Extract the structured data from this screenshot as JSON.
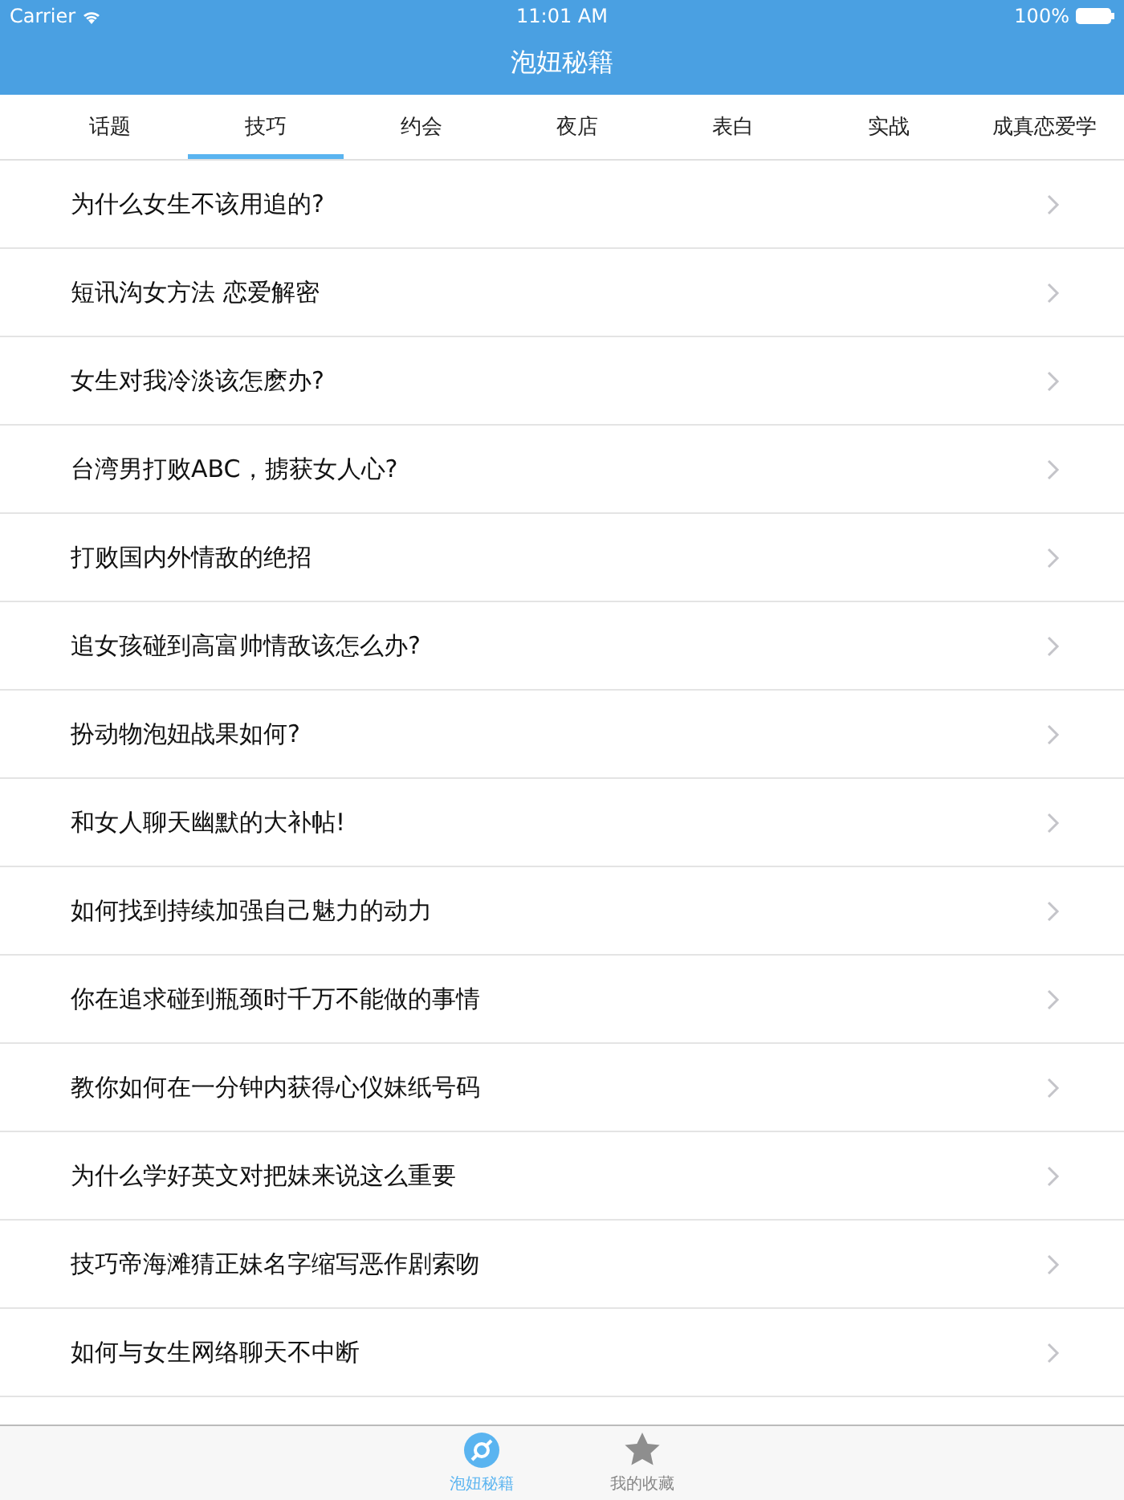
{
  "status_bar": {
    "carrier": "Carrier",
    "time": "11:01 AM",
    "battery": "100%"
  },
  "nav_bar": {
    "title": "泡妞秘籍"
  },
  "tabs": [
    {
      "label": "话题",
      "selected": false
    },
    {
      "label": "技巧",
      "selected": true
    },
    {
      "label": "约会",
      "selected": false
    },
    {
      "label": "夜店",
      "selected": false
    },
    {
      "label": "表白",
      "selected": false
    },
    {
      "label": "实战",
      "selected": false
    },
    {
      "label": "成真恋爱学",
      "selected": false
    }
  ],
  "articles": [
    {
      "title": "为什么女生不该用追的?"
    },
    {
      "title": "短讯沟女方法 恋爱解密"
    },
    {
      "title": "女生对我冷淡该怎麽办?"
    },
    {
      "title": "台湾男打败ABC，掳获女人心?"
    },
    {
      "title": "打败国内外情敌的绝招"
    },
    {
      "title": "追女孩碰到高富帅情敌该怎么办?"
    },
    {
      "title": "扮动物泡妞战果如何?"
    },
    {
      "title": "和女人聊天幽默的大补帖!"
    },
    {
      "title": "如何找到持续加强自己魅力的动力"
    },
    {
      "title": "你在追求碰到瓶颈时千万不能做的事情"
    },
    {
      "title": "教你如何在一分钟内获得心仪妹纸号码"
    },
    {
      "title": "为什么学好英文对把妹来说这么重要"
    },
    {
      "title": "技巧帝海滩猜正妹名字缩写恶作剧索吻"
    },
    {
      "title": "如何与女生网络聊天不中断"
    }
  ],
  "tab_bar": [
    {
      "label": "泡妞秘籍",
      "kind": "disc",
      "selected": true
    },
    {
      "label": "我的收藏",
      "kind": "star",
      "selected": false
    }
  ]
}
